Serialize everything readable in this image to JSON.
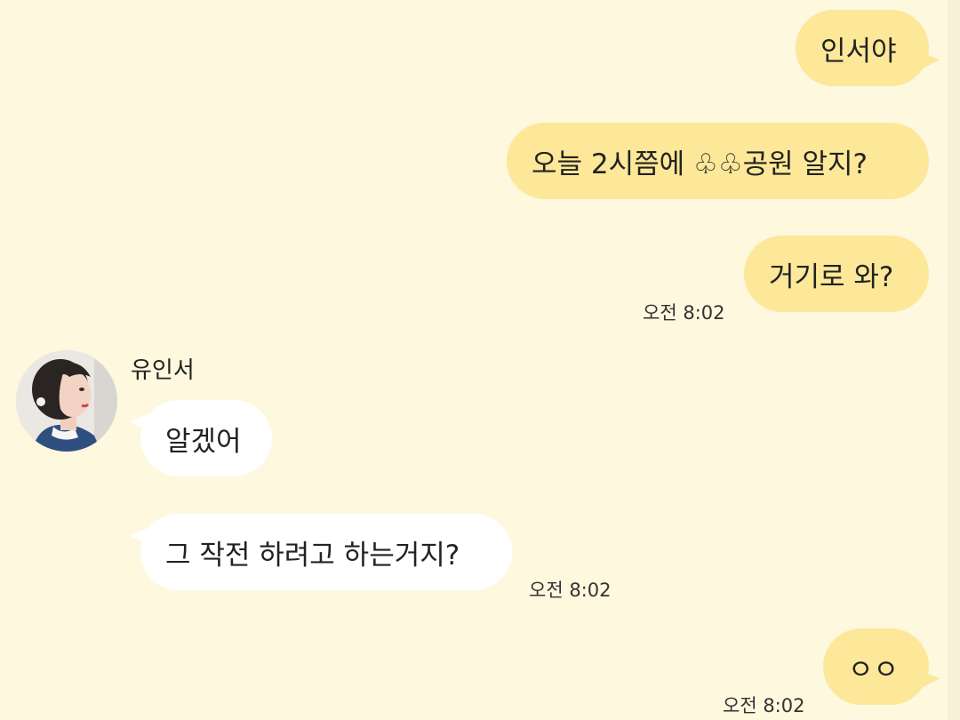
{
  "colors": {
    "background": "#fdf8de",
    "outgoing_bubble": "#fce898",
    "incoming_bubble": "#ffffff"
  },
  "messages": {
    "m1": "인서야",
    "m2": "오늘 2시쯤에 ♧♧공원 알지?",
    "m3": "거기로 와?",
    "m3_time": "오전 8:02",
    "sender_name": "유인서",
    "m4": "알겠어",
    "m5": "그 작전 하려고 하는거지?",
    "m5_time": "오전 8:02",
    "m6": "ㅇㅇ",
    "m6_time": "오전 8:02"
  },
  "avatar_icon": "profile-photo"
}
